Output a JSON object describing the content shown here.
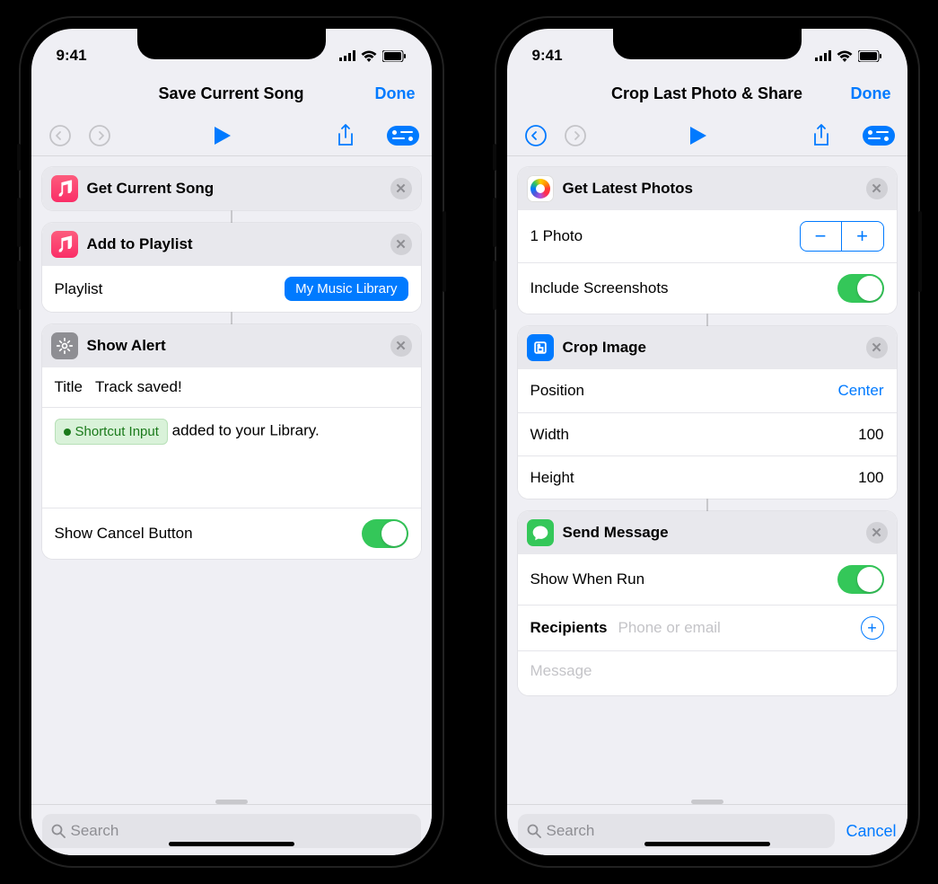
{
  "status": {
    "time": "9:41"
  },
  "phones": [
    {
      "nav_title": "Save Current Song",
      "done": "Done",
      "undo_enabled": false,
      "actions": {
        "get_song": {
          "title": "Get Current Song"
        },
        "add_playlist": {
          "title": "Add to Playlist",
          "param_label": "Playlist",
          "param_value": "My Music Library"
        },
        "show_alert": {
          "title": "Show Alert",
          "title_field_label": "Title",
          "title_field_value": "Track saved!",
          "token_label": "Shortcut Input",
          "body_suffix": " added to your Library.",
          "cancel_label": "Show Cancel Button",
          "cancel_on": true
        }
      },
      "search_placeholder": "Search",
      "show_cancel_bottom": false
    },
    {
      "nav_title": "Crop Last Photo & Share",
      "done": "Done",
      "undo_enabled": true,
      "actions": {
        "get_photos": {
          "title": "Get Latest Photos",
          "count_label": "1 Photo",
          "screenshots_label": "Include Screenshots",
          "screenshots_on": true
        },
        "crop": {
          "title": "Crop Image",
          "position_label": "Position",
          "position_value": "Center",
          "width_label": "Width",
          "width_value": "100",
          "height_label": "Height",
          "height_value": "100"
        },
        "send": {
          "title": "Send Message",
          "show_run_label": "Show When Run",
          "show_run_on": true,
          "recipients_label": "Recipients",
          "recipients_placeholder": "Phone or email",
          "message_placeholder": "Message"
        }
      },
      "search_placeholder": "Search",
      "bottom_cancel": "Cancel",
      "show_cancel_bottom": true
    }
  ]
}
